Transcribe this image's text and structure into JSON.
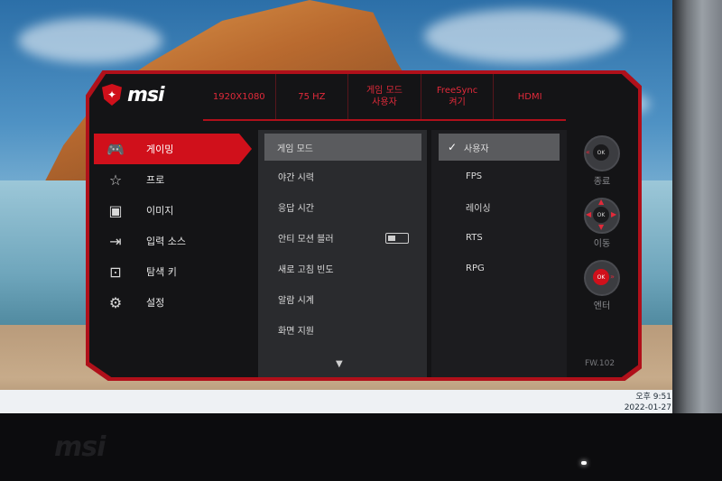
{
  "osd": {
    "logo": "msi",
    "infobar": [
      {
        "line1": "1920X1080",
        "line2": ""
      },
      {
        "line1": "75 HZ",
        "line2": ""
      },
      {
        "line1": "게임 모드",
        "line2": "사용자"
      },
      {
        "line1": "FreeSync",
        "line2": "켜기"
      },
      {
        "line1": "HDMI",
        "line2": ""
      }
    ],
    "menu": [
      {
        "label": "게이밍",
        "icon": "gamepad-icon",
        "glyph": "🎮",
        "active": true
      },
      {
        "label": "프로",
        "icon": "star-icon",
        "glyph": "☆",
        "active": false
      },
      {
        "label": "이미지",
        "icon": "image-icon",
        "glyph": "▣",
        "active": false
      },
      {
        "label": "입력 소스",
        "icon": "input-source-icon",
        "glyph": "⇥",
        "active": false
      },
      {
        "label": "탐색 키",
        "icon": "navi-key-icon",
        "glyph": "⊡",
        "active": false
      },
      {
        "label": "설정",
        "icon": "settings-gear-icon",
        "glyph": "⚙",
        "active": false
      }
    ],
    "submenu": [
      {
        "label": "게임 모드",
        "active": true
      },
      {
        "label": "야간 시력",
        "active": false
      },
      {
        "label": "응답 시간",
        "active": false
      },
      {
        "label": "안티 모션 블러",
        "active": false,
        "toggle": false
      },
      {
        "label": "새로 고침 빈도",
        "active": false
      },
      {
        "label": "알람 시계",
        "active": false
      },
      {
        "label": "화면 지원",
        "active": false
      }
    ],
    "options": [
      {
        "label": "사용자",
        "selected": true
      },
      {
        "label": "FPS",
        "selected": false
      },
      {
        "label": "레이싱",
        "selected": false
      },
      {
        "label": "RTS",
        "selected": false
      },
      {
        "label": "RPG",
        "selected": false
      }
    ],
    "nav": [
      {
        "label": "종료",
        "center": "OK"
      },
      {
        "label": "이동",
        "center": "OK"
      },
      {
        "label": "엔터",
        "center": "OK"
      }
    ],
    "firmware": "FW.102"
  },
  "taskbar": {
    "time": "오후 9:51",
    "date": "2022-01-27"
  },
  "monitor": {
    "brand": "msi"
  },
  "colors": {
    "accent": "#d0101b",
    "panel": "#141416",
    "highlight": "#5a5b5e"
  }
}
